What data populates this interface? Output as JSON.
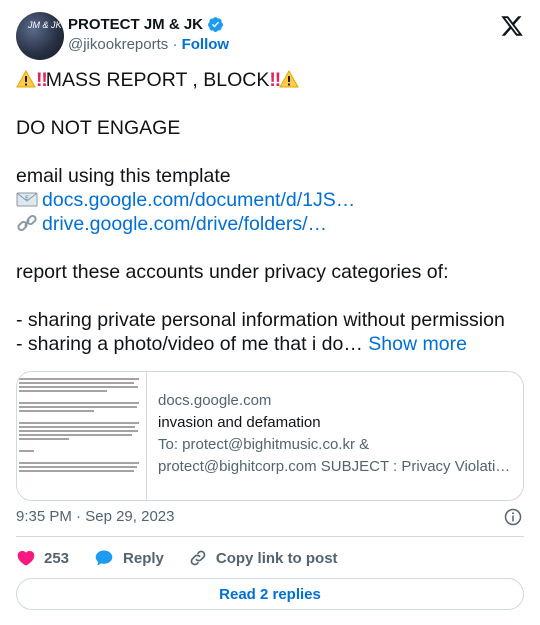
{
  "header": {
    "display_name": "PROTECT JM & JK",
    "handle": "@jikookreports",
    "separator": "·",
    "follow_label": "Follow"
  },
  "tweet": {
    "line1": "MASS REPORT , BLOCK",
    "line2": "DO NOT ENGAGE",
    "line3": "email using this template",
    "link1": "docs.google.com/document/d/1JS…",
    "link2": "drive.google.com/drive/folders/…",
    "line4": "report these accounts under privacy categories of:",
    "line5": "- sharing private personal information without permission",
    "line6": "- sharing a photo/video of me that i do…",
    "show_more": "Show more"
  },
  "preview": {
    "domain": "docs.google.com",
    "title": "invasion and defamation",
    "description": "To: protect@bighitmusic.co.kr & protect@bighitcorp.com SUBJECT : Privacy Violati…"
  },
  "meta": {
    "time": "9:35 PM",
    "separator": "·",
    "date": "Sep 29, 2023"
  },
  "actions": {
    "like_count": "253",
    "reply_label": "Reply",
    "copy_label": "Copy link to post"
  },
  "replies_button": "Read 2 replies",
  "colors": {
    "accent": "#006fd6",
    "like": "#f91880",
    "reply": "#1d9bf0",
    "muted": "#536471",
    "border": "#cfd9de"
  }
}
